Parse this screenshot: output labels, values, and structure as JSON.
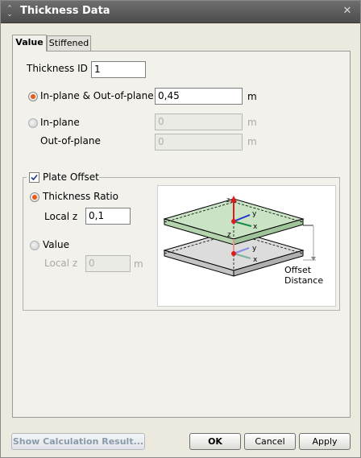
{
  "window": {
    "title": "Thickness Data"
  },
  "tabs": [
    {
      "label": "Value"
    },
    {
      "label": "Stiffened"
    }
  ],
  "thickness_id": {
    "label": "Thickness ID",
    "value": "1"
  },
  "in_out_plane": {
    "label": "In-plane & Out-of-plane",
    "value": "0,45",
    "unit": "m",
    "selected": true
  },
  "in_plane": {
    "label": "In-plane",
    "value": "0",
    "unit": "m",
    "selected": false
  },
  "out_of_plane": {
    "label": "Out-of-plane",
    "value": "0",
    "unit": "m"
  },
  "plate_offset": {
    "label": "Plate Offset",
    "checked": true,
    "thickness_ratio": {
      "label": "Thickness Ratio",
      "selected": true,
      "local_z_label": "Local z",
      "local_z_value": "0,1"
    },
    "value_option": {
      "label": "Value",
      "selected": false,
      "local_z_label": "Local z",
      "local_z_value": "0",
      "unit": "m"
    }
  },
  "diagram": {
    "offset_label_line1": "Offset",
    "offset_label_line2": "Distance",
    "axis_z": "z",
    "axis_y": "y",
    "axis_x": "x"
  },
  "buttons": {
    "show_calc": "Show Calculation Result...",
    "ok": "OK",
    "cancel": "Cancel",
    "apply": "Apply"
  },
  "colors": {
    "title_bg": "#5a5a5a",
    "radio_selected": "#e85a1b",
    "plate_top": "#c9e3c4",
    "plate_bottom": "#dcdcdc"
  }
}
